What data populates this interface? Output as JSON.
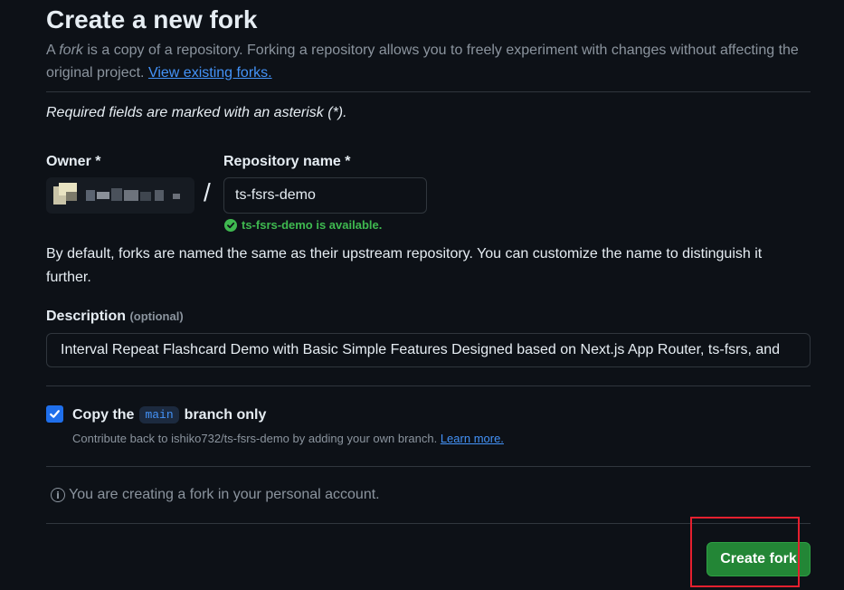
{
  "page": {
    "title": "Create a new fork",
    "intro_prefix": "A ",
    "intro_fork_word": "fork",
    "intro_rest": " is a copy of a repository. Forking a repository allows you to freely experiment with changes without affecting the original project. ",
    "view_forks_link": "View existing forks."
  },
  "form": {
    "required_note": "Required fields are marked with an asterisk (*).",
    "owner_label": "Owner *",
    "owner_value_icon": "pixelated-avatar",
    "slash": "/",
    "repo_label": "Repository name *",
    "repo_value": "ts-fsrs-demo",
    "repo_available": "ts-fsrs-demo is available.",
    "default_note": "By default, forks are named the same as their upstream repository. You can customize the name to distinguish it further.",
    "description_label": "Description",
    "description_optional": "(optional)",
    "description_value": "Interval Repeat Flashcard Demo with Basic Simple Features Designed based on Next.js App Router, ts-fsrs, and",
    "copy_prefix": "Copy the",
    "copy_branch": "main",
    "copy_suffix": "branch only",
    "copy_checked": true,
    "copy_hint": "Contribute back to ishiko732/ts-fsrs-demo by adding your own branch. ",
    "learn_more": "Learn more.",
    "info_text": "You are creating a fork in your personal account.",
    "create_button": "Create fork"
  },
  "colors": {
    "background": "#0d1117",
    "accent_link": "#4493f8",
    "success": "#3fb950",
    "primary_button": "#238636",
    "highlight": "#e5202f"
  }
}
